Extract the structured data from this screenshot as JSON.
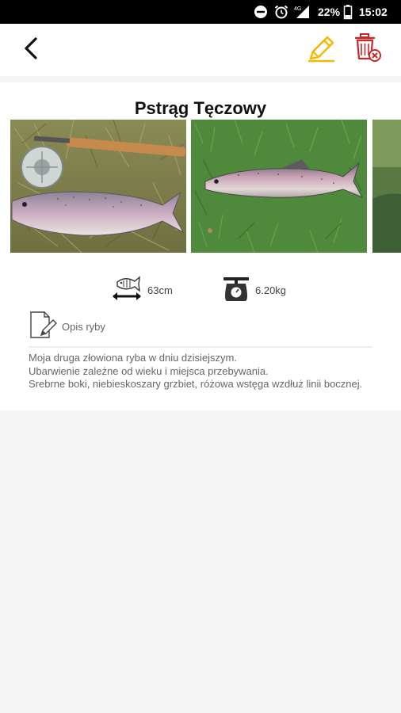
{
  "status_bar": {
    "battery": "22%",
    "time": "15:02",
    "network": "4G"
  },
  "app_bar": {
    "back_icon": "chevron-left-icon",
    "edit_icon": "pencil-icon",
    "delete_icon": "trash-delete-icon",
    "edit_color": "#F5B800",
    "delete_color": "#C62828"
  },
  "fish": {
    "name": "Pstrąg Tęczowy",
    "length": "63cm",
    "weight": "6.20kg",
    "description_label": "Opis ryby",
    "description_lines": [
      "Moja druga złowiona ryba w dniu dzisiejszym.",
      "Ubarwienie zależne od wieku i miejsca przebywania.",
      "Srebrne boki, niebieskoszary grzbiet, różowa wstęga wzdłuż linii bocznej."
    ]
  }
}
